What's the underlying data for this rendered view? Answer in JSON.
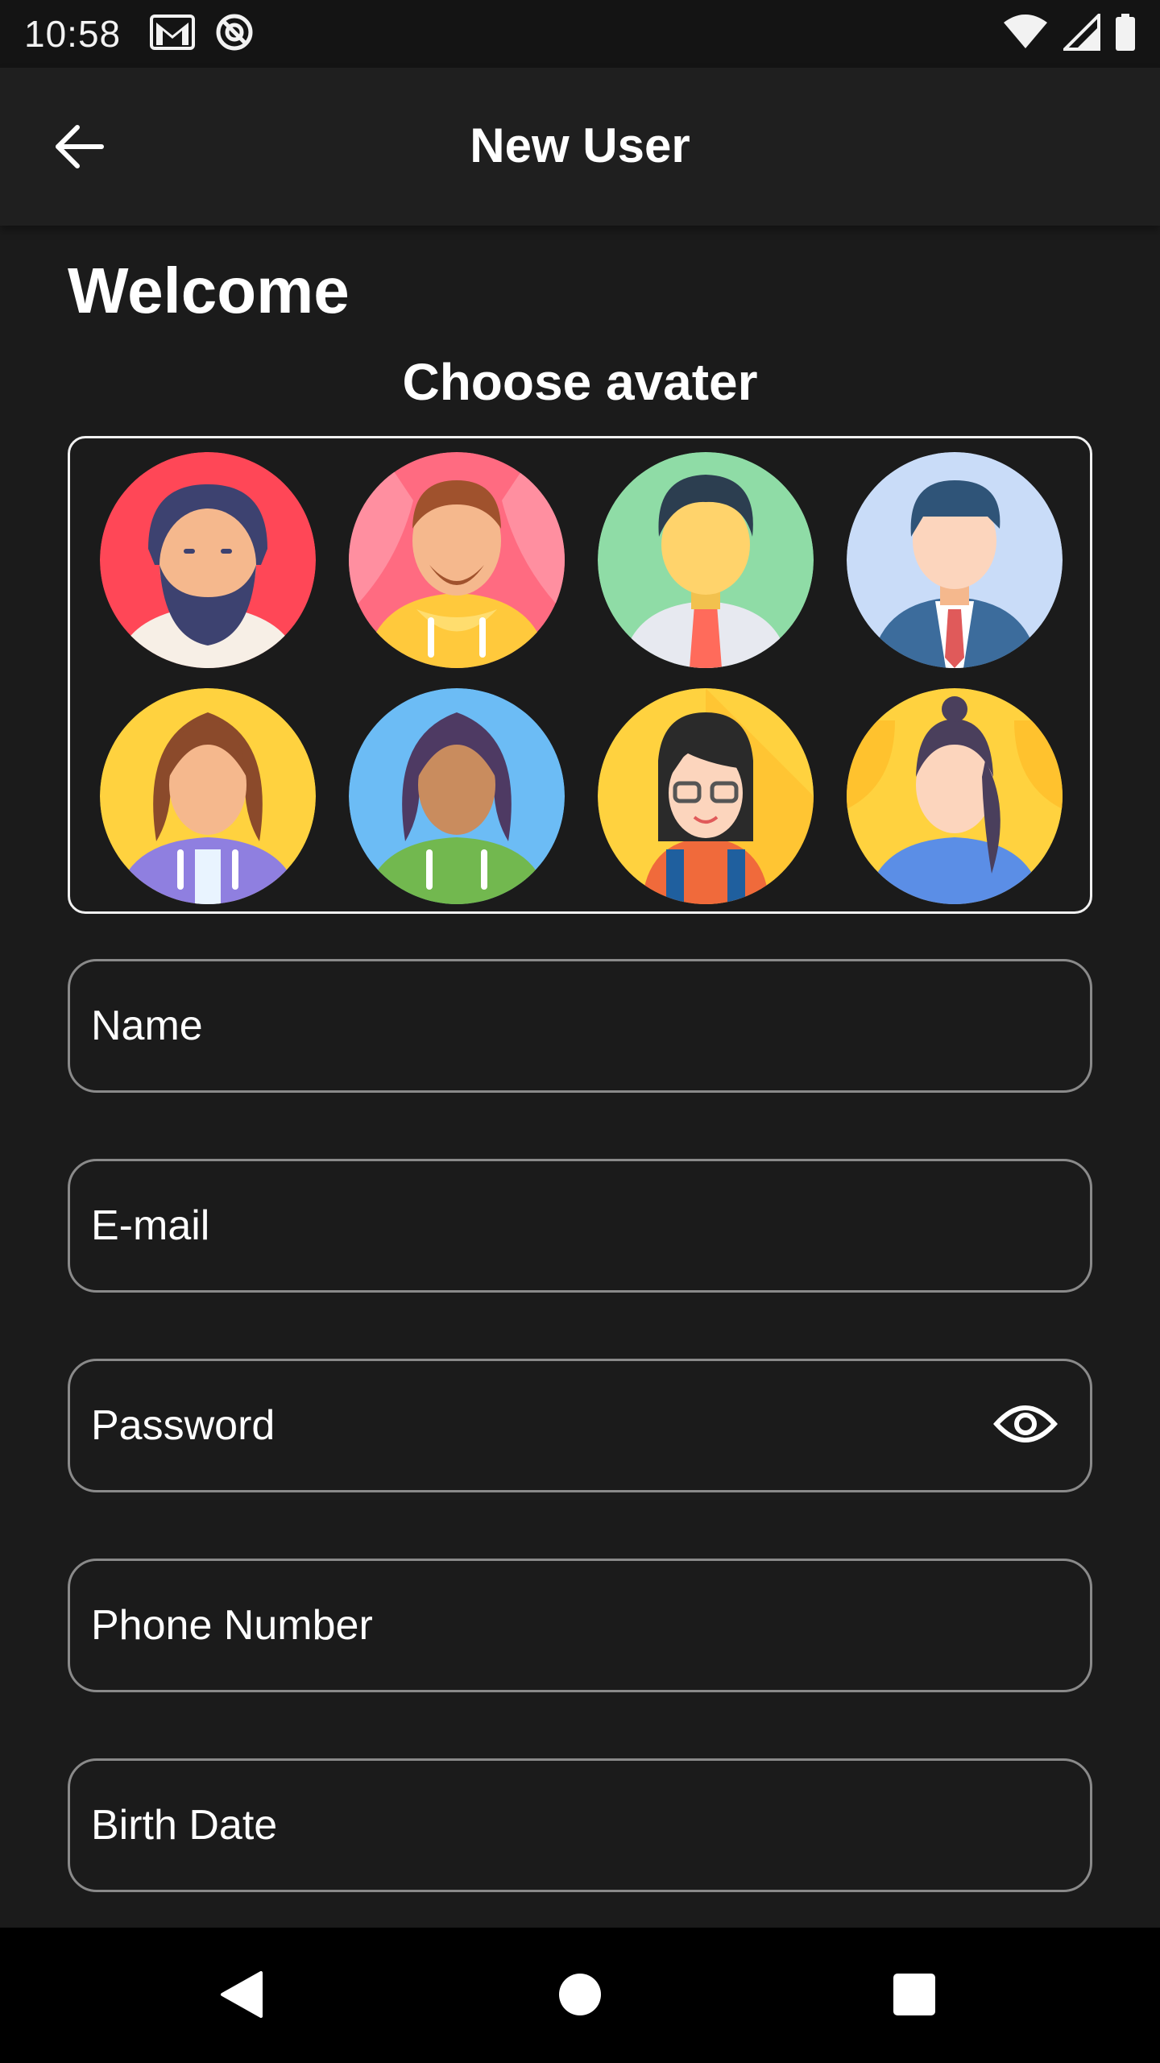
{
  "status_bar": {
    "time": "10:58",
    "left_icons": [
      "gmail-icon",
      "no-disturb-icon"
    ],
    "right_icons": [
      "wifi-icon",
      "signal-icon",
      "battery-icon"
    ]
  },
  "app_bar": {
    "back_icon": "arrow-left-icon",
    "title": "New User"
  },
  "welcome": "Welcome",
  "choose_avatar_label": "Choose avater",
  "avatars": [
    {
      "name": "bearded-man",
      "bg": "#ff4757"
    },
    {
      "name": "hoodie-man",
      "bg": "#ff6b81"
    },
    {
      "name": "man-tie-green",
      "bg": "#8fdca6"
    },
    {
      "name": "man-suit-blue",
      "bg": "#c9dcf8"
    },
    {
      "name": "woman-purple-hoodie",
      "bg": "#ffd23f"
    },
    {
      "name": "woman-green-hoodie",
      "bg": "#6cbcf5"
    },
    {
      "name": "woman-glasses",
      "bg": "#ffd23f"
    },
    {
      "name": "woman-ponytail",
      "bg": "#ffd23f"
    }
  ],
  "fields": {
    "name": "Name",
    "email": "E-mail",
    "password": "Password",
    "password_icon": "eye-icon",
    "phone": "Phone Number",
    "birth_date": "Birth Date"
  },
  "nav_bar": {
    "back": "triangle-back-icon",
    "home": "circle-home-icon",
    "recents": "square-recents-icon"
  }
}
